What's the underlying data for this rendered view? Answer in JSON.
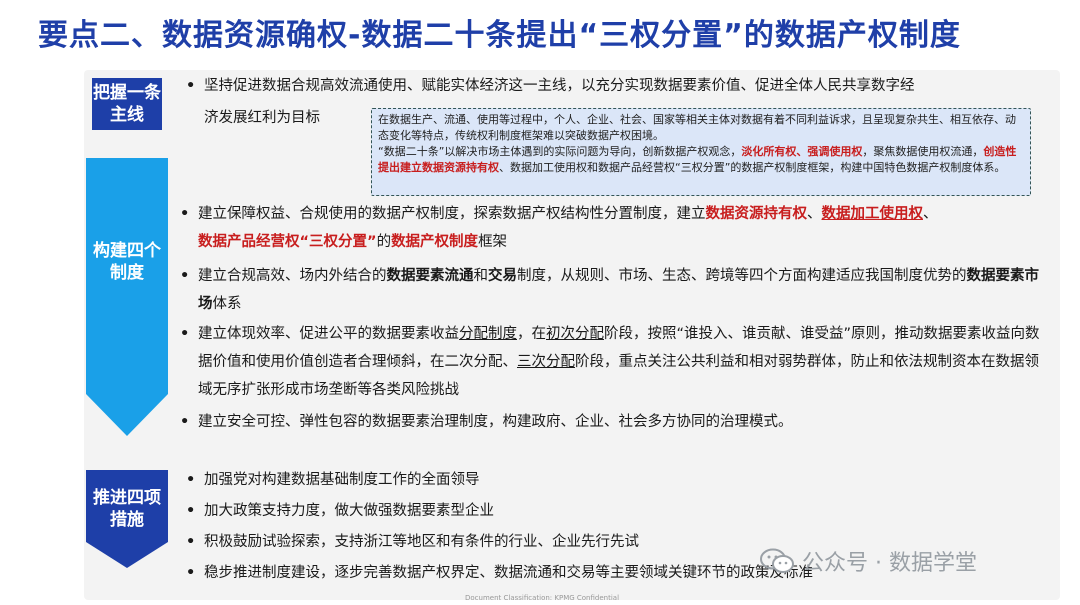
{
  "title": "要点二、数据资源确权-数据二十条提出“三权分置”的数据产权制度",
  "labels": {
    "l1": [
      "把握一条",
      "主线"
    ],
    "l2": [
      "构建四个",
      "制度"
    ],
    "l3": [
      "推进四项",
      "措施"
    ]
  },
  "mainline": {
    "line1": "坚持促进数据合规高效流通使用、赋能实体经济这一主线，以充分实现数据要素价值、促进全体人民共享数字经",
    "line2": "济发展红利为目标"
  },
  "infobox": {
    "p1": "在数据生产、流通、使用等过程中，个人、企业、社会、国家等相关主体对数据有着不同利益诉求，且呈现复杂共生、相互依存、动态变化等特点，传统权利制度框架难以突破数据产权困境。",
    "p2a": "“数据二十条”以解决市场主体遇到的实际问题为导向，创新数据产权观念，",
    "p2b": "淡化所有权、强调使用权",
    "p2c": "，聚焦数据使用权流通，",
    "p2d": "创造性提出建立数据资源持有权",
    "p2e": "、数据加工使用权和数据产品经营权“三权分置”的数据产权制度框架，构建中国特色数据产权制度体系。"
  },
  "systems": {
    "s1a": "建立保障权益、合规使用的数据产权制度，探索数据产权结构性分置制度，建立",
    "s1b": "数据资源持有权",
    "s1c": "、",
    "s1d": "数据加工使用权",
    "s1e": "、",
    "s1f": "数据产品经营权“三权分置”",
    "s1g": "的",
    "s1h": "数据产权制度",
    "s1i": "框架",
    "s2a": "建立合规高效、场内外结合的",
    "s2b": "数据要素流通",
    "s2c": "和",
    "s2d": "交易",
    "s2e": "制度，从规则、市场、生态、跨境等四个方面构建适应我国制度优势的",
    "s2f": "数据要素市场",
    "s2g": "体系",
    "s3a": "建立体现效率、促进公平的数据要素收益",
    "s3b": "分配制度",
    "s3c": "，在",
    "s3d": "初次分配",
    "s3e": "阶段，按照“谁投入、谁贡献、谁受益”原则，推动数据要素收益向数据价值和使用价值创造者合理倾斜，在二次分配、",
    "s3f": "三次分配",
    "s3g": "阶段，重点关注公共利益和相对弱势群体，防止和依法规制资本在数据领域无序扩张形成市场垄断等各类风险挑战",
    "s4": "建立安全可控、弹性包容的数据要素治理制度，构建政府、企业、社会多方协同的治理模式。"
  },
  "measures": [
    "加强党对构建数据基础制度工作的全面领导",
    "加大政策支持力度，做大做强数据要素型企业",
    "积极鼓励试验探索，支持浙江等地区和有条件的行业、企业先行先试",
    "稳步推进制度建设，逐步完善数据产权界定、数据流通和交易等主要领域关键环节的政策及标准"
  ],
  "bullet": "•",
  "watermark": "公众号 · 数据学堂",
  "footer": "Document Classification: KPMG Confidential",
  "colors": {
    "title": "#1f3fa8",
    "label_bg": "#1e3fa8",
    "arrow": "#1aa0e8",
    "accent_red": "#c81e1e"
  }
}
